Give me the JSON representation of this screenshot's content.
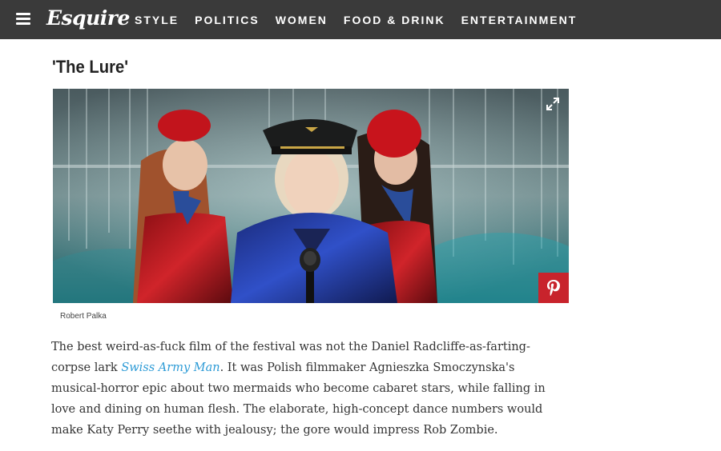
{
  "header": {
    "brand": "Esquire",
    "nav": [
      "STYLE",
      "POLITICS",
      "WOMEN",
      "FOOD & DRINK",
      "ENTERTAINMENT"
    ],
    "bg_color": "#3a3a3a",
    "menu_icon": "hamburger-menu-icon"
  },
  "slide": {
    "title": "'The Lure'",
    "photo_credit": "Robert Palka",
    "expand_icon": "expand-icon",
    "pin_icon": "pinterest-icon",
    "pin_color": "#c8232c"
  },
  "article": {
    "text_before_link": "The best weird-as-fuck film of the festival was not the Daniel Radcliffe-as-farting-corpse lark ",
    "link_text": "Swiss Army Man",
    "text_after_link": ". It was Polish filmmaker Agnieszka Smoczynska's musical-horror epic about two mermaids who become cabaret stars, while falling in love and dining on human flesh. The elaborate, high-concept dance numbers would make Katy Perry seethe with jealousy; the gore would impress Rob Zombie.",
    "link_color": "#2d9bd6"
  }
}
